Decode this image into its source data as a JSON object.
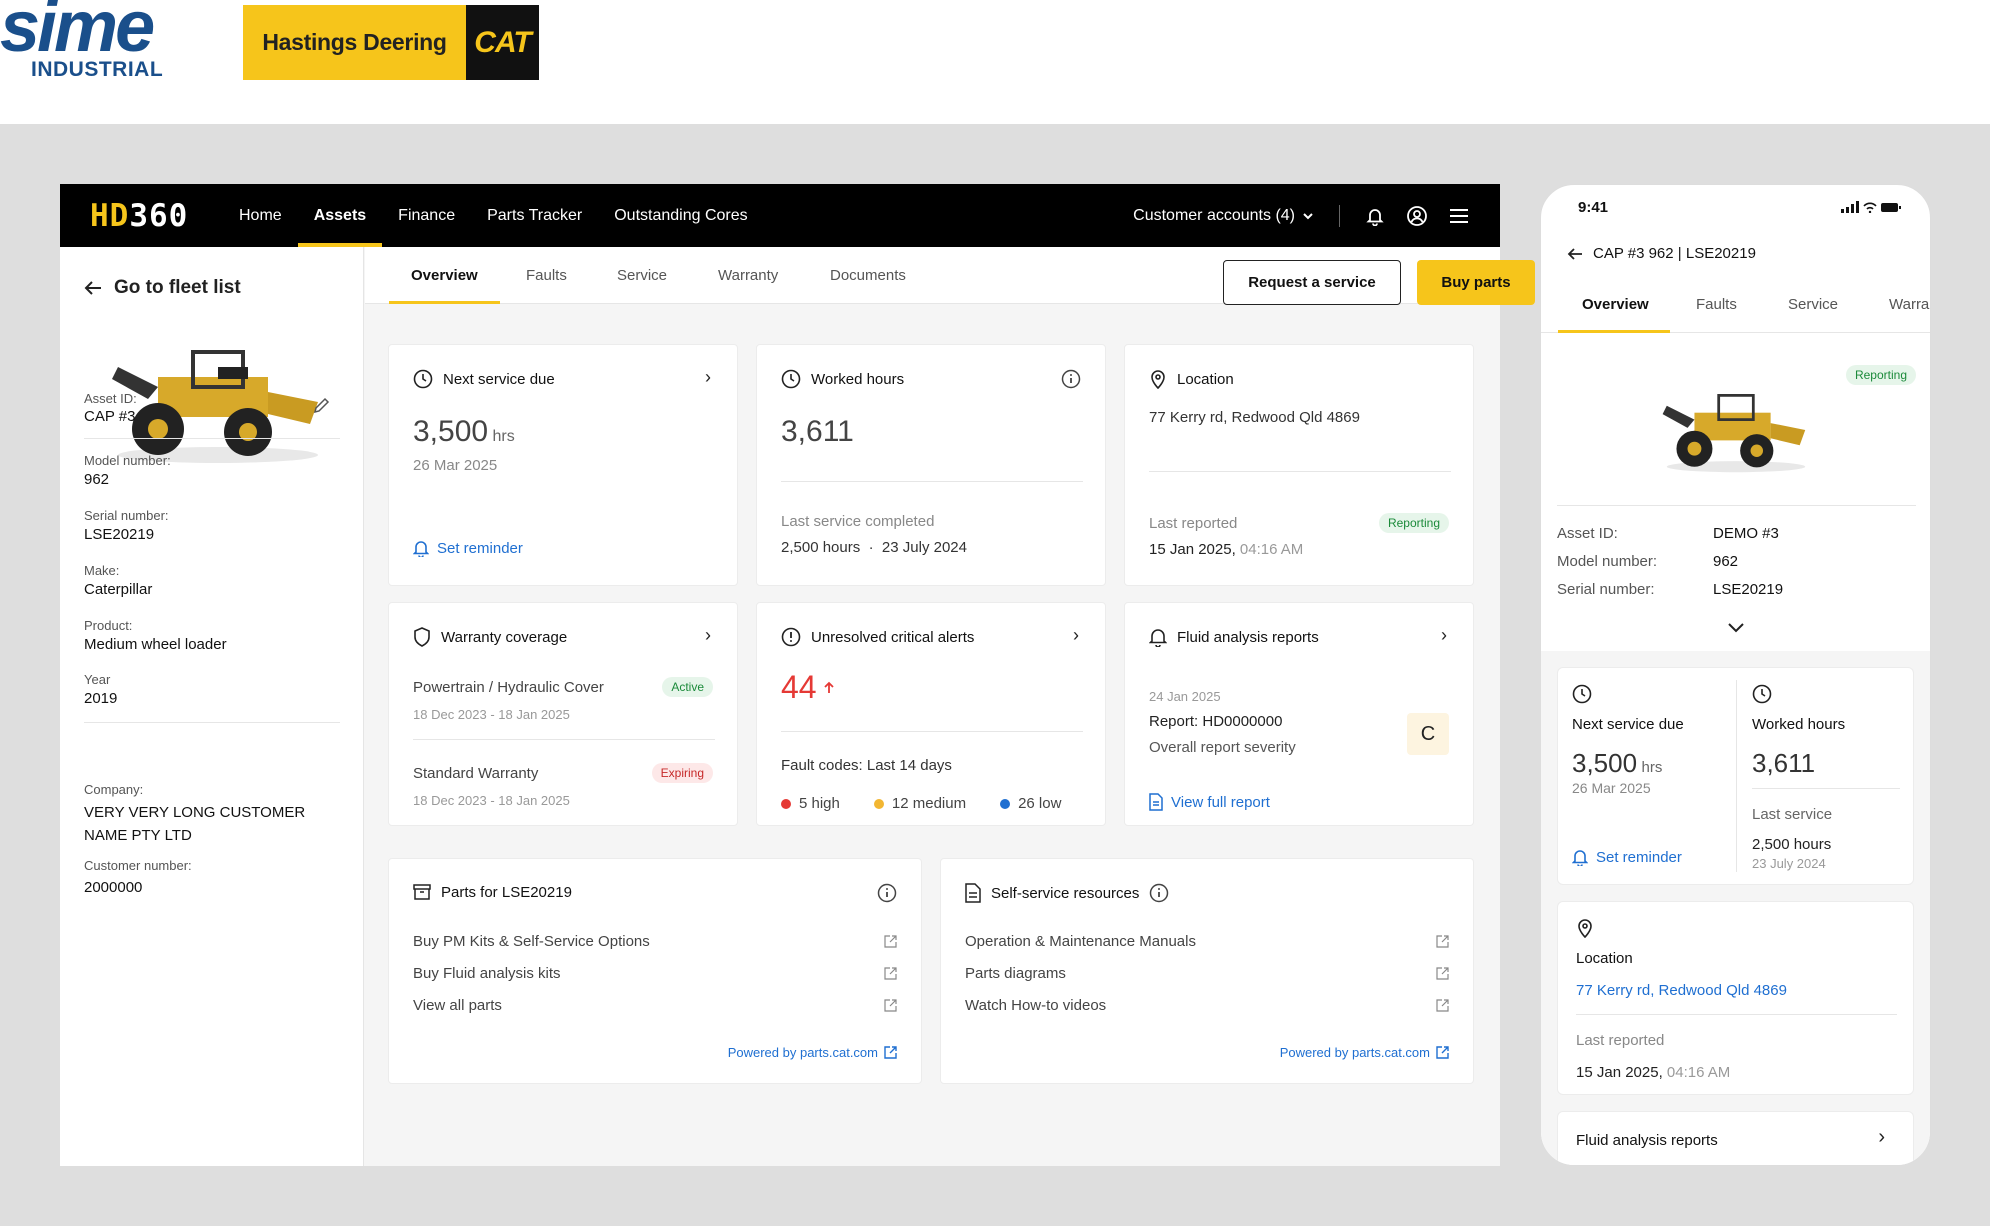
{
  "logos": {
    "sime_word": "sime",
    "sime_sub": "INDUSTRIAL",
    "hastings": "Hastings Deering",
    "cat": "CAT"
  },
  "nav": {
    "brand_hd": "HD",
    "brand_num": "360",
    "links": [
      "Home",
      "Assets",
      "Finance",
      "Parts Tracker",
      "Outstanding Cores"
    ],
    "customer_accounts": "Customer accounts (4)"
  },
  "sidebar": {
    "back": "Go to fleet list",
    "asset_id_label": "Asset ID:",
    "asset_id": "CAP #3",
    "model_label": "Model number:",
    "model": "962",
    "serial_label": "Serial number:",
    "serial": "LSE20219",
    "make_label": "Make:",
    "make": "Caterpillar",
    "product_label": "Product:",
    "product": "Medium wheel loader",
    "year_label": "Year",
    "year": "2019",
    "company_label": "Company:",
    "company_line1": "VERY VERY LONG CUSTOMER",
    "company_line2": "NAME PTY LTD",
    "customer_number_label": "Customer number:",
    "customer_number": "2000000"
  },
  "tabs": [
    "Overview",
    "Faults",
    "Service",
    "Warranty",
    "Documents"
  ],
  "actions": {
    "request_service": "Request a service",
    "buy_parts": "Buy parts"
  },
  "cards": {
    "next_service": {
      "title": "Next service due",
      "value": "3,500",
      "unit": "hrs",
      "date": "26 Mar 2025",
      "reminder": "Set reminder"
    },
    "worked_hours": {
      "title": "Worked hours",
      "value": "3,611",
      "last_label": "Last service completed",
      "last_hours": "2,500 hours",
      "sep": "·",
      "last_date": "23 July 2024"
    },
    "location": {
      "title": "Location",
      "address": "77 Kerry rd, Redwood Qld 4869",
      "last_label": "Last reported",
      "status": "Reporting",
      "date": "15 Jan 2025,",
      "time": "04:16 AM"
    },
    "warranty": {
      "title": "Warranty coverage",
      "items": [
        {
          "name": "Powertrain / Hydraulic Cover",
          "status": "Active",
          "range": "18 Dec 2023 - 18 Jan 2025"
        },
        {
          "name": "Standard Warranty",
          "status": "Expiring",
          "range": "18 Dec 2023 - 18 Jan 2025"
        }
      ]
    },
    "alerts": {
      "title": "Unresolved critical alerts",
      "value": "44",
      "fault_codes": "Fault codes: Last 14 days",
      "high": "5 high",
      "medium": "12 medium",
      "low": "26 low",
      "colors": {
        "high": "#e53935",
        "medium": "#f2b632",
        "low": "#1f6fd1"
      }
    },
    "fluid": {
      "title": "Fluid analysis reports",
      "date": "24 Jan 2025",
      "report": "Report: HD0000000",
      "severity_label": "Overall report severity",
      "grade": "C",
      "view": "View full report"
    },
    "parts": {
      "title": "Parts for LSE20219",
      "links": [
        "Buy PM Kits & Self-Service Options",
        "Buy Fluid analysis kits",
        "View all parts"
      ],
      "powered": "Powered by parts.cat.com"
    },
    "self_service": {
      "title": "Self-service resources",
      "links": [
        "Operation & Maintenance Manuals",
        "Parts diagrams",
        "Watch How-to videos"
      ],
      "powered": "Powered by parts.cat.com"
    }
  },
  "phone": {
    "time": "9:41",
    "title": "CAP #3 962 | LSE20219",
    "tabs": [
      "Overview",
      "Faults",
      "Service",
      "Warra"
    ],
    "status": "Reporting",
    "asset_id_label": "Asset ID:",
    "asset_id": "DEMO #3",
    "model_label": "Model number:",
    "model": "962",
    "serial_label": "Serial number:",
    "serial": "LSE20219",
    "next_service_title": "Next service due",
    "next_service_value": "3,500",
    "next_service_unit": "hrs",
    "next_service_date": "26 Mar 2025",
    "reminder": "Set reminder",
    "worked_title": "Worked hours",
    "worked_value": "3,611",
    "last_service_label": "Last service",
    "last_service_hours": "2,500 hours",
    "last_service_date": "23 July 2024",
    "location_title": "Location",
    "location_address": "77 Kerry rd, Redwood Qld 4869",
    "last_reported_label": "Last reported",
    "last_reported_date": "15 Jan 2025,",
    "last_reported_time": "04:16 AM",
    "fluid_title": "Fluid analysis reports"
  },
  "colors": {
    "accent": "#f6c51b",
    "link": "#1f6fd1",
    "alert": "#e53935"
  }
}
